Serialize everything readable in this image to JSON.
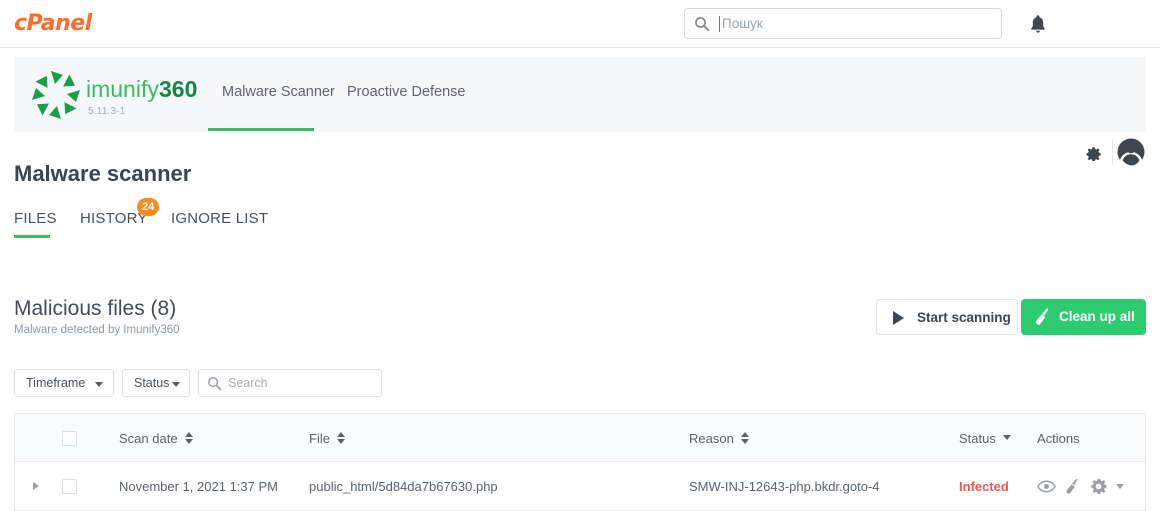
{
  "cpanel": {
    "logo_text": "cPanel",
    "search": {
      "placeholder": "Пошук",
      "value": ""
    },
    "bell_icon": "bell-icon"
  },
  "imunify": {
    "product_name": "imunify360",
    "version": "5.11.3-1",
    "nav": [
      {
        "label": "Malware Scanner",
        "active": true
      },
      {
        "label": "Proactive Defense",
        "active": false
      }
    ],
    "gear_icon": "gear-icon",
    "avatar_icon": "user-avatar-icon"
  },
  "page": {
    "title": "Malware scanner",
    "tabs": [
      {
        "label": "FILES",
        "active": true,
        "badge": ""
      },
      {
        "label": "HISTORY",
        "active": false,
        "badge": "24"
      },
      {
        "label": "IGNORE LIST",
        "active": false,
        "badge": ""
      }
    ]
  },
  "section": {
    "title": "Malicious files (8)",
    "subtitle": "Malware detected by Imunify360",
    "start_scanning_label": "Start scanning",
    "clean_up_all_label": "Clean up all"
  },
  "filters": {
    "timeframe_label": "Timeframe",
    "status_label": "Status",
    "search_placeholder": "Search",
    "search_value": ""
  },
  "table": {
    "columns": [
      {
        "label": "Scan date",
        "sort": "both"
      },
      {
        "label": "File",
        "sort": "both"
      },
      {
        "label": "Reason",
        "sort": "both"
      },
      {
        "label": "Status",
        "sort": "desc"
      },
      {
        "label": "Actions",
        "sort": "none"
      }
    ],
    "rows": [
      {
        "scan_date": "November 1, 2021 1:37 PM",
        "file": "public_html/5d84da7b67630.php",
        "reason": "SMW-INJ-12643-php.bkdr.goto-4",
        "status": "Infected",
        "actions": [
          "eye-icon",
          "broom-icon",
          "gear-icon"
        ]
      }
    ]
  },
  "colors": {
    "cpanel_orange": "#ff6c2c",
    "imunify_green": "#3cba62",
    "clean_button_green": "#2ecc71",
    "badge_orange": "#f68b1f",
    "infected_red": "#f2574a"
  }
}
